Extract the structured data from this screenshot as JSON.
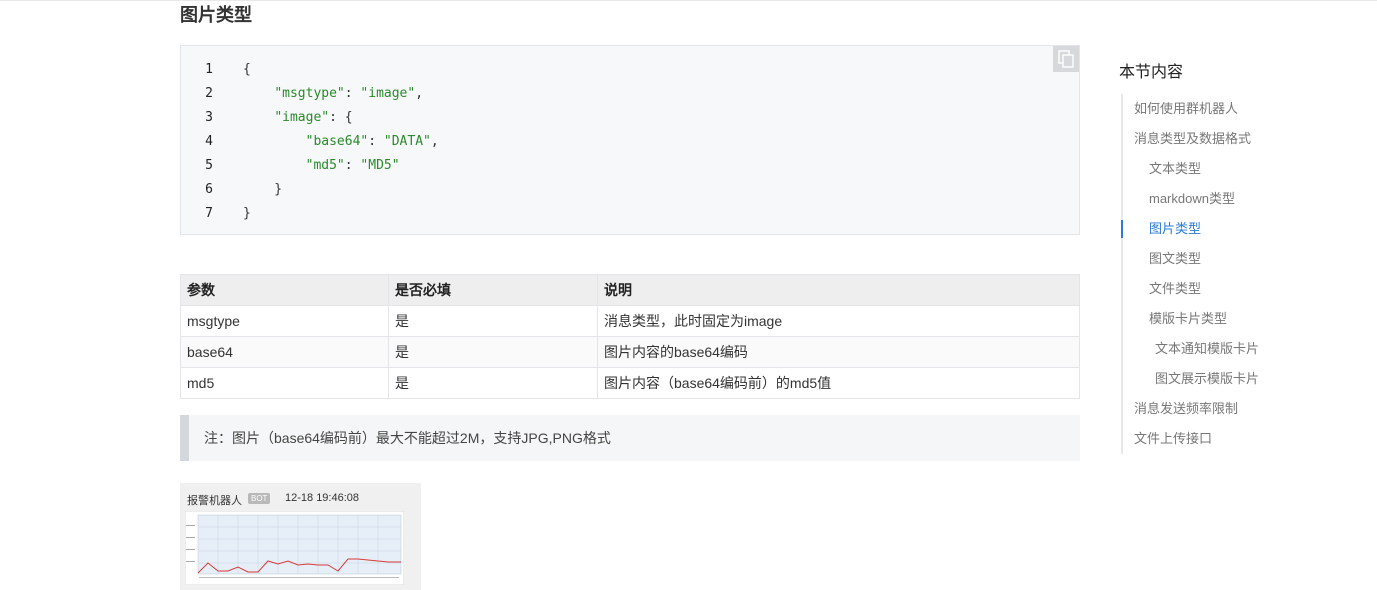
{
  "section_title": "图片类型",
  "code": {
    "lines": [
      {
        "num": "1",
        "parts": [
          {
            "t": "{",
            "s": false
          }
        ]
      },
      {
        "num": "2",
        "parts": [
          {
            "t": "    ",
            "s": false
          },
          {
            "t": "\"msgtype\"",
            "s": true
          },
          {
            "t": ": ",
            "s": false
          },
          {
            "t": "\"image\"",
            "s": true
          },
          {
            "t": ",",
            "s": false
          }
        ]
      },
      {
        "num": "3",
        "parts": [
          {
            "t": "    ",
            "s": false
          },
          {
            "t": "\"image\"",
            "s": true
          },
          {
            "t": ": {",
            "s": false
          }
        ]
      },
      {
        "num": "4",
        "parts": [
          {
            "t": "        ",
            "s": false
          },
          {
            "t": "\"base64\"",
            "s": true
          },
          {
            "t": ": ",
            "s": false
          },
          {
            "t": "\"DATA\"",
            "s": true
          },
          {
            "t": ",",
            "s": false
          }
        ]
      },
      {
        "num": "5",
        "parts": [
          {
            "t": "        ",
            "s": false
          },
          {
            "t": "\"md5\"",
            "s": true
          },
          {
            "t": ": ",
            "s": false
          },
          {
            "t": "\"MD5\"",
            "s": true
          }
        ]
      },
      {
        "num": "6",
        "parts": [
          {
            "t": "    }",
            "s": false
          }
        ]
      },
      {
        "num": "7",
        "parts": [
          {
            "t": "}",
            "s": false
          }
        ]
      }
    ],
    "copy_icon": "copy-icon"
  },
  "table": {
    "headers": [
      "参数",
      "是否必填",
      "说明"
    ],
    "rows": [
      [
        "msgtype",
        "是",
        "消息类型，此时固定为image"
      ],
      [
        "base64",
        "是",
        "图片内容的base64编码"
      ],
      [
        "md5",
        "是",
        "图片内容（base64编码前）的md5值"
      ]
    ]
  },
  "note": "注：图片（base64编码前）最大不能超过2M，支持JPG,PNG格式",
  "preview": {
    "bot_name": "报警机器人",
    "badge": "BOT",
    "time": "12-18 19:46:08"
  },
  "toc": {
    "title": "本节内容",
    "items": [
      {
        "label": "如何使用群机器人",
        "level": 1,
        "active": false
      },
      {
        "label": "消息类型及数据格式",
        "level": 1,
        "active": false
      },
      {
        "label": "文本类型",
        "level": 2,
        "active": false
      },
      {
        "label": "markdown类型",
        "level": 2,
        "active": false
      },
      {
        "label": "图片类型",
        "level": 2,
        "active": true
      },
      {
        "label": "图文类型",
        "level": 2,
        "active": false
      },
      {
        "label": "文件类型",
        "level": 2,
        "active": false
      },
      {
        "label": "模版卡片类型",
        "level": 2,
        "active": false
      },
      {
        "label": "文本通知模版卡片",
        "level": 3,
        "active": false
      },
      {
        "label": "图文展示模版卡片",
        "level": 3,
        "active": false
      },
      {
        "label": "消息发送频率限制",
        "level": 1,
        "active": false
      },
      {
        "label": "文件上传接口",
        "level": 1,
        "active": false
      }
    ],
    "active_color": "#2b7ad4"
  }
}
